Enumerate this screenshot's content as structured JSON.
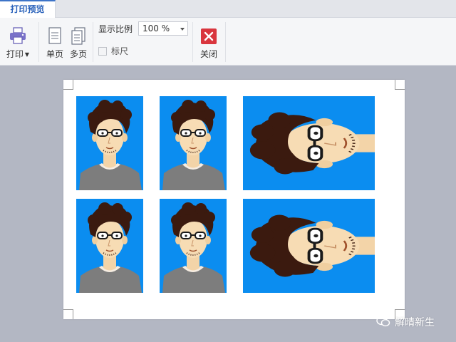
{
  "tab": {
    "label": "打印预览"
  },
  "toolbar": {
    "print_label": "打印",
    "single_page_label": "单页",
    "multi_page_label": "多页",
    "zoom_label": "显示比例",
    "zoom_value": "100 %",
    "ruler_label": "标尺",
    "close_label": "关闭"
  },
  "icons": {
    "print": "printer-icon",
    "single_page": "single-page-icon",
    "multi_page": "multi-page-icon",
    "close": "close-icon"
  },
  "colors": {
    "accent": "#2a62bb",
    "photo_bg": "#0b8df0",
    "close_red": "#d9363e",
    "workspace": "#b3b7c3"
  },
  "photos": [
    {
      "orientation": "portrait"
    },
    {
      "orientation": "portrait"
    },
    {
      "orientation": "landscape"
    },
    {
      "orientation": "portrait"
    },
    {
      "orientation": "portrait"
    },
    {
      "orientation": "landscape"
    }
  ],
  "watermark": {
    "text": "解晴新生"
  }
}
